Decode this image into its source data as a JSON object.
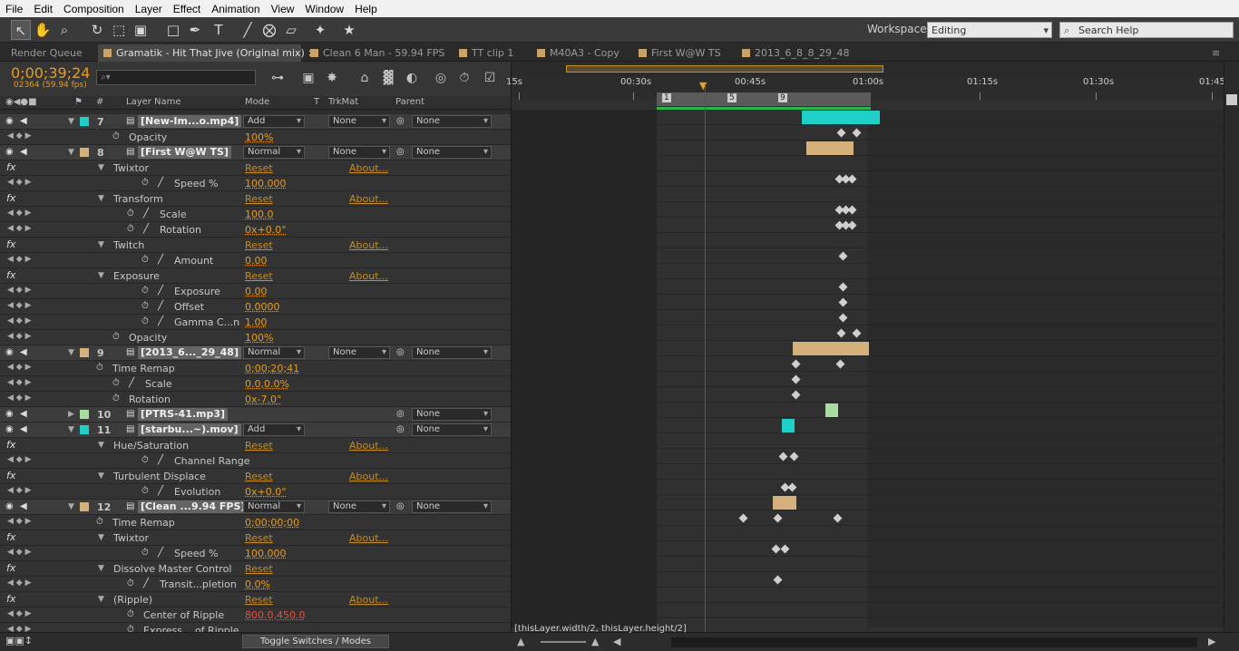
{
  "menu": [
    "File",
    "Edit",
    "Composition",
    "Layer",
    "Effect",
    "Animation",
    "View",
    "Window",
    "Help"
  ],
  "toolbar": {
    "tools": [
      "selection-tool-icon",
      "hand-tool-icon",
      "zoom-tool-icon",
      "rotation-tool-icon",
      "camera-tool-icon",
      "pan-behind-tool-icon",
      "rectangle-tool-icon",
      "text-tool-icon",
      "brush-tool-icon",
      "eraser-tool-icon",
      "roto-brush-tool-icon",
      "puppet-tool-icon"
    ],
    "workspace_label": "Workspace:",
    "workspace_value": "Editing",
    "search_help": "Search Help"
  },
  "tabs": [
    {
      "label": "Render Queue"
    },
    {
      "label": "Gramatik - Hit That Jive (Original mix)"
    },
    {
      "label": "Clean 6 Man - 59.94 FPS"
    },
    {
      "label": "TT clip 1"
    },
    {
      "label": "M40A3 - Copy"
    },
    {
      "label": "First W@W TS"
    },
    {
      "label": "2013_6_8_8_29_48"
    }
  ],
  "timecode": "0;00;39;24",
  "frame_info": "02364 (59.94 fps)",
  "search_placeholder": "⌕▾",
  "columns": {
    "label": "#",
    "layer_name": "Layer Name",
    "mode": "Mode",
    "t": "T",
    "trkmat": "TrkMat",
    "parent": "Parent"
  },
  "ruler": {
    "labels": [
      "15s",
      "00:30s",
      "00:45s",
      "01:00s",
      "01:15s",
      "01:30s",
      "01:45"
    ],
    "marker_1": "1",
    "marker_5": "5",
    "marker_9": "9"
  },
  "layers": [
    {
      "num": "7",
      "name": "[New-Im...o.mp4]",
      "mode": "Add",
      "trkmat": "None",
      "parent": "None",
      "color": "#1fd0c8"
    },
    {
      "num": "8",
      "name": "[First W@W TS]",
      "mode": "Normal",
      "trkmat": "None",
      "parent": "None",
      "color": "#d4b07a"
    },
    {
      "num": "9",
      "name": "[2013_6..._29_48]",
      "mode": "Normal",
      "trkmat": "None",
      "parent": "None",
      "color": "#d4b07a"
    },
    {
      "num": "10",
      "name": "[PTRS-41.mp3]",
      "parent": "None",
      "color": "#a8dca0"
    },
    {
      "num": "11",
      "name": "[starbu...~).mov]",
      "mode": "Add",
      "parent": "None",
      "color": "#1fd0c8"
    },
    {
      "num": "12",
      "name": "[Clean ...9.94 FPS]",
      "mode": "Normal",
      "trkmat": "None",
      "parent": "None",
      "color": "#d4b07a"
    }
  ],
  "props": {
    "opacity": "Opacity",
    "opacity_val": "100%",
    "twixtor": "Twixtor",
    "reset": "Reset",
    "about": "About...",
    "speed": "Speed %",
    "speed_val": "100.000",
    "transform": "Transform",
    "scale": "Scale",
    "scale_val": "100.0",
    "rotation": "Rotation",
    "rotation_val": "0x+0.0°",
    "twitch": "Twitch",
    "amount": "Amount",
    "amount_val": "0.00",
    "exposure_grp": "Exposure",
    "exposure": "Exposure",
    "exposure_val": "0.00",
    "offset": "Offset",
    "offset_val": "0.0000",
    "gamma": "Gamma C...n",
    "gamma_val": "1.00",
    "time_remap": "Time Remap",
    "time_remap_val9": "0;00;20;41",
    "scale_val9": "0.0,0.0%",
    "rotation_val9": "0x-7.0°",
    "hue_sat": "Hue/Saturation",
    "channel_range": "Channel Range",
    "turb_disp": "Turbulent Displace",
    "evolution": "Evolution",
    "evolution_val": "0x+0.0°",
    "time_remap_val12": "0;00;00;00",
    "dissolve": "Dissolve Master Control",
    "transit": "Transit...pletion",
    "transit_val": "0.0%",
    "ripple": "(Ripple)",
    "center_ripple": "Center of Ripple",
    "center_ripple_val": "800.0,450.0",
    "express": "Express... of Ripple"
  },
  "bottom": {
    "toggle": "Toggle Switches / Modes",
    "expression": "[thisLayer.width/2, thisLayer.height/2]"
  }
}
